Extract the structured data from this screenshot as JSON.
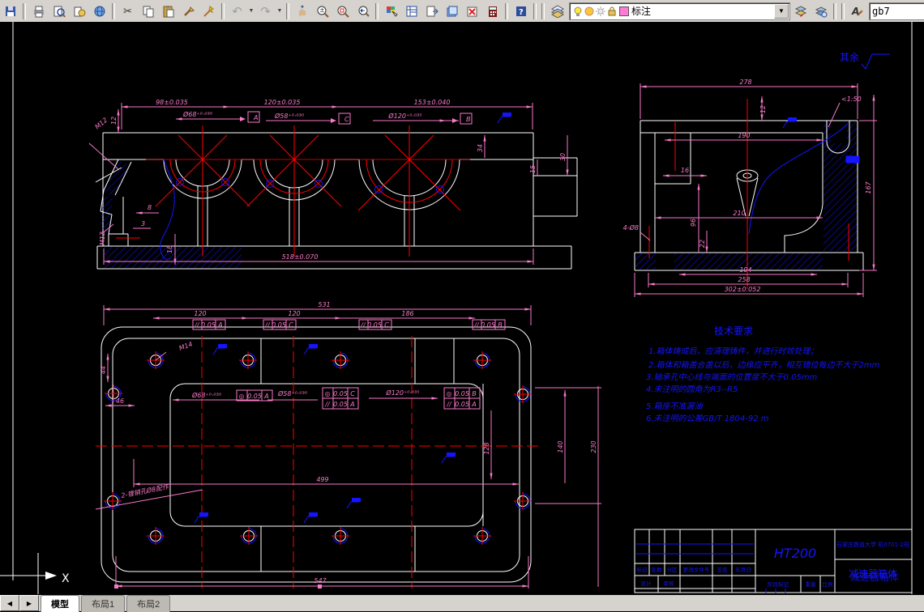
{
  "toolbar": {
    "layer_combo": {
      "value": "标注",
      "swatch_color": "#ff7bd5"
    },
    "style_combo": {
      "value": "gb7"
    },
    "glyphs": {
      "undo": "↶",
      "redo": "↷",
      "cut": "✂",
      "help": "?"
    }
  },
  "tabs": {
    "items": [
      "模型",
      "布局1",
      "布局2"
    ],
    "active": "模型"
  },
  "ucs": {
    "axis_x": "X"
  },
  "drawing": {
    "colors": {
      "dimension": "#f879c8",
      "geometry": "#ffffff",
      "centerline": "#ff0000",
      "detail": "#1414ff"
    },
    "surface_note": {
      "label": "其余"
    },
    "tech_requirements": {
      "title": "技术要求",
      "items": [
        "1.箱体铸成后，应清理铸件，并进行时效处理；",
        "2.箱体和箱盖合盖以后，边缘应平齐，相互错位每边不大于2mm",
        "3.轴承孔中心线与端面的位置度不大于0.05mm",
        "4.未注明的圆角为R3--R5",
        "5.箱座不准漏油",
        "6.未注明的公差GB/T 1804-92 m"
      ]
    },
    "title_block": {
      "material": "HT200",
      "school": "石家庄铁道大学  机0701-2班",
      "part_name": "减速器箱体",
      "cols": [
        "标记",
        "处数",
        "分区",
        "更改文件号",
        "签名",
        "年月日"
      ],
      "design": "设计",
      "check": "审核",
      "stage": "阶段标记",
      "weight": "重量",
      "scale": "比例"
    },
    "front": {
      "cc1": "98±0.035",
      "cc2": "120±0.035",
      "cc3": "153±0.040",
      "d1": "Ø68⁺⁰·⁰³⁰",
      "d2": "Ø58⁺⁰·⁰³⁰",
      "d3": "Ø120⁺⁰·⁰³⁵",
      "datum_a": "A",
      "datum_c": "C",
      "datum_b": "B",
      "v12": "12",
      "v34": "34",
      "v15": "15",
      "v30": "30",
      "v8": "8",
      "v3": "3",
      "v18": "18",
      "m12a": "M12",
      "m12b": "M12",
      "base": "518±0.070"
    },
    "side": {
      "s278": "278",
      "s12": "12",
      "s190": "190",
      "s16": "16",
      "s210": "210",
      "s96": "96",
      "s22": "22",
      "s194": "194",
      "s258": "258",
      "s302": "302±0.052",
      "s167": "167",
      "draft": "<1:50",
      "pin": "4-Ø8"
    },
    "top": {
      "t531": "531",
      "t120a": "120",
      "t120b": "120",
      "t186": "186",
      "t44": "44",
      "t46": "46",
      "t499": "499",
      "t547": "547",
      "t140": "140",
      "t230": "230",
      "t128": "128",
      "m14": "M14",
      "d1": "Ø68⁺⁰·⁰³⁰",
      "d2": "Ø58⁺⁰·⁰³⁰",
      "d3": "Ø120⁺⁰·⁰³⁵",
      "pin_note": "2-锥销孔Ø8配作"
    },
    "gdt": {
      "tf": [
        {
          "sym": "//",
          "tol": "0.05",
          "datum": "A"
        },
        {
          "sym": "//",
          "tol": "0.05",
          "datum": "C"
        },
        {
          "sym": "//",
          "tol": "0.05",
          "datum": "C"
        },
        {
          "sym": "//",
          "tol": "0.05",
          "datum": "B"
        }
      ],
      "l1": {
        "sym": "◎",
        "tol": "0.05",
        "datum": "A"
      },
      "l2a": {
        "sym": "◎",
        "tol": "0.05",
        "datum": "C"
      },
      "l2b": {
        "sym": "//",
        "tol": "0.05",
        "datum": "A"
      },
      "l3a": {
        "sym": "◎",
        "tol": "0.05",
        "datum": "B"
      },
      "l3b": {
        "sym": "//",
        "tol": "0.05",
        "datum": "A"
      }
    }
  }
}
